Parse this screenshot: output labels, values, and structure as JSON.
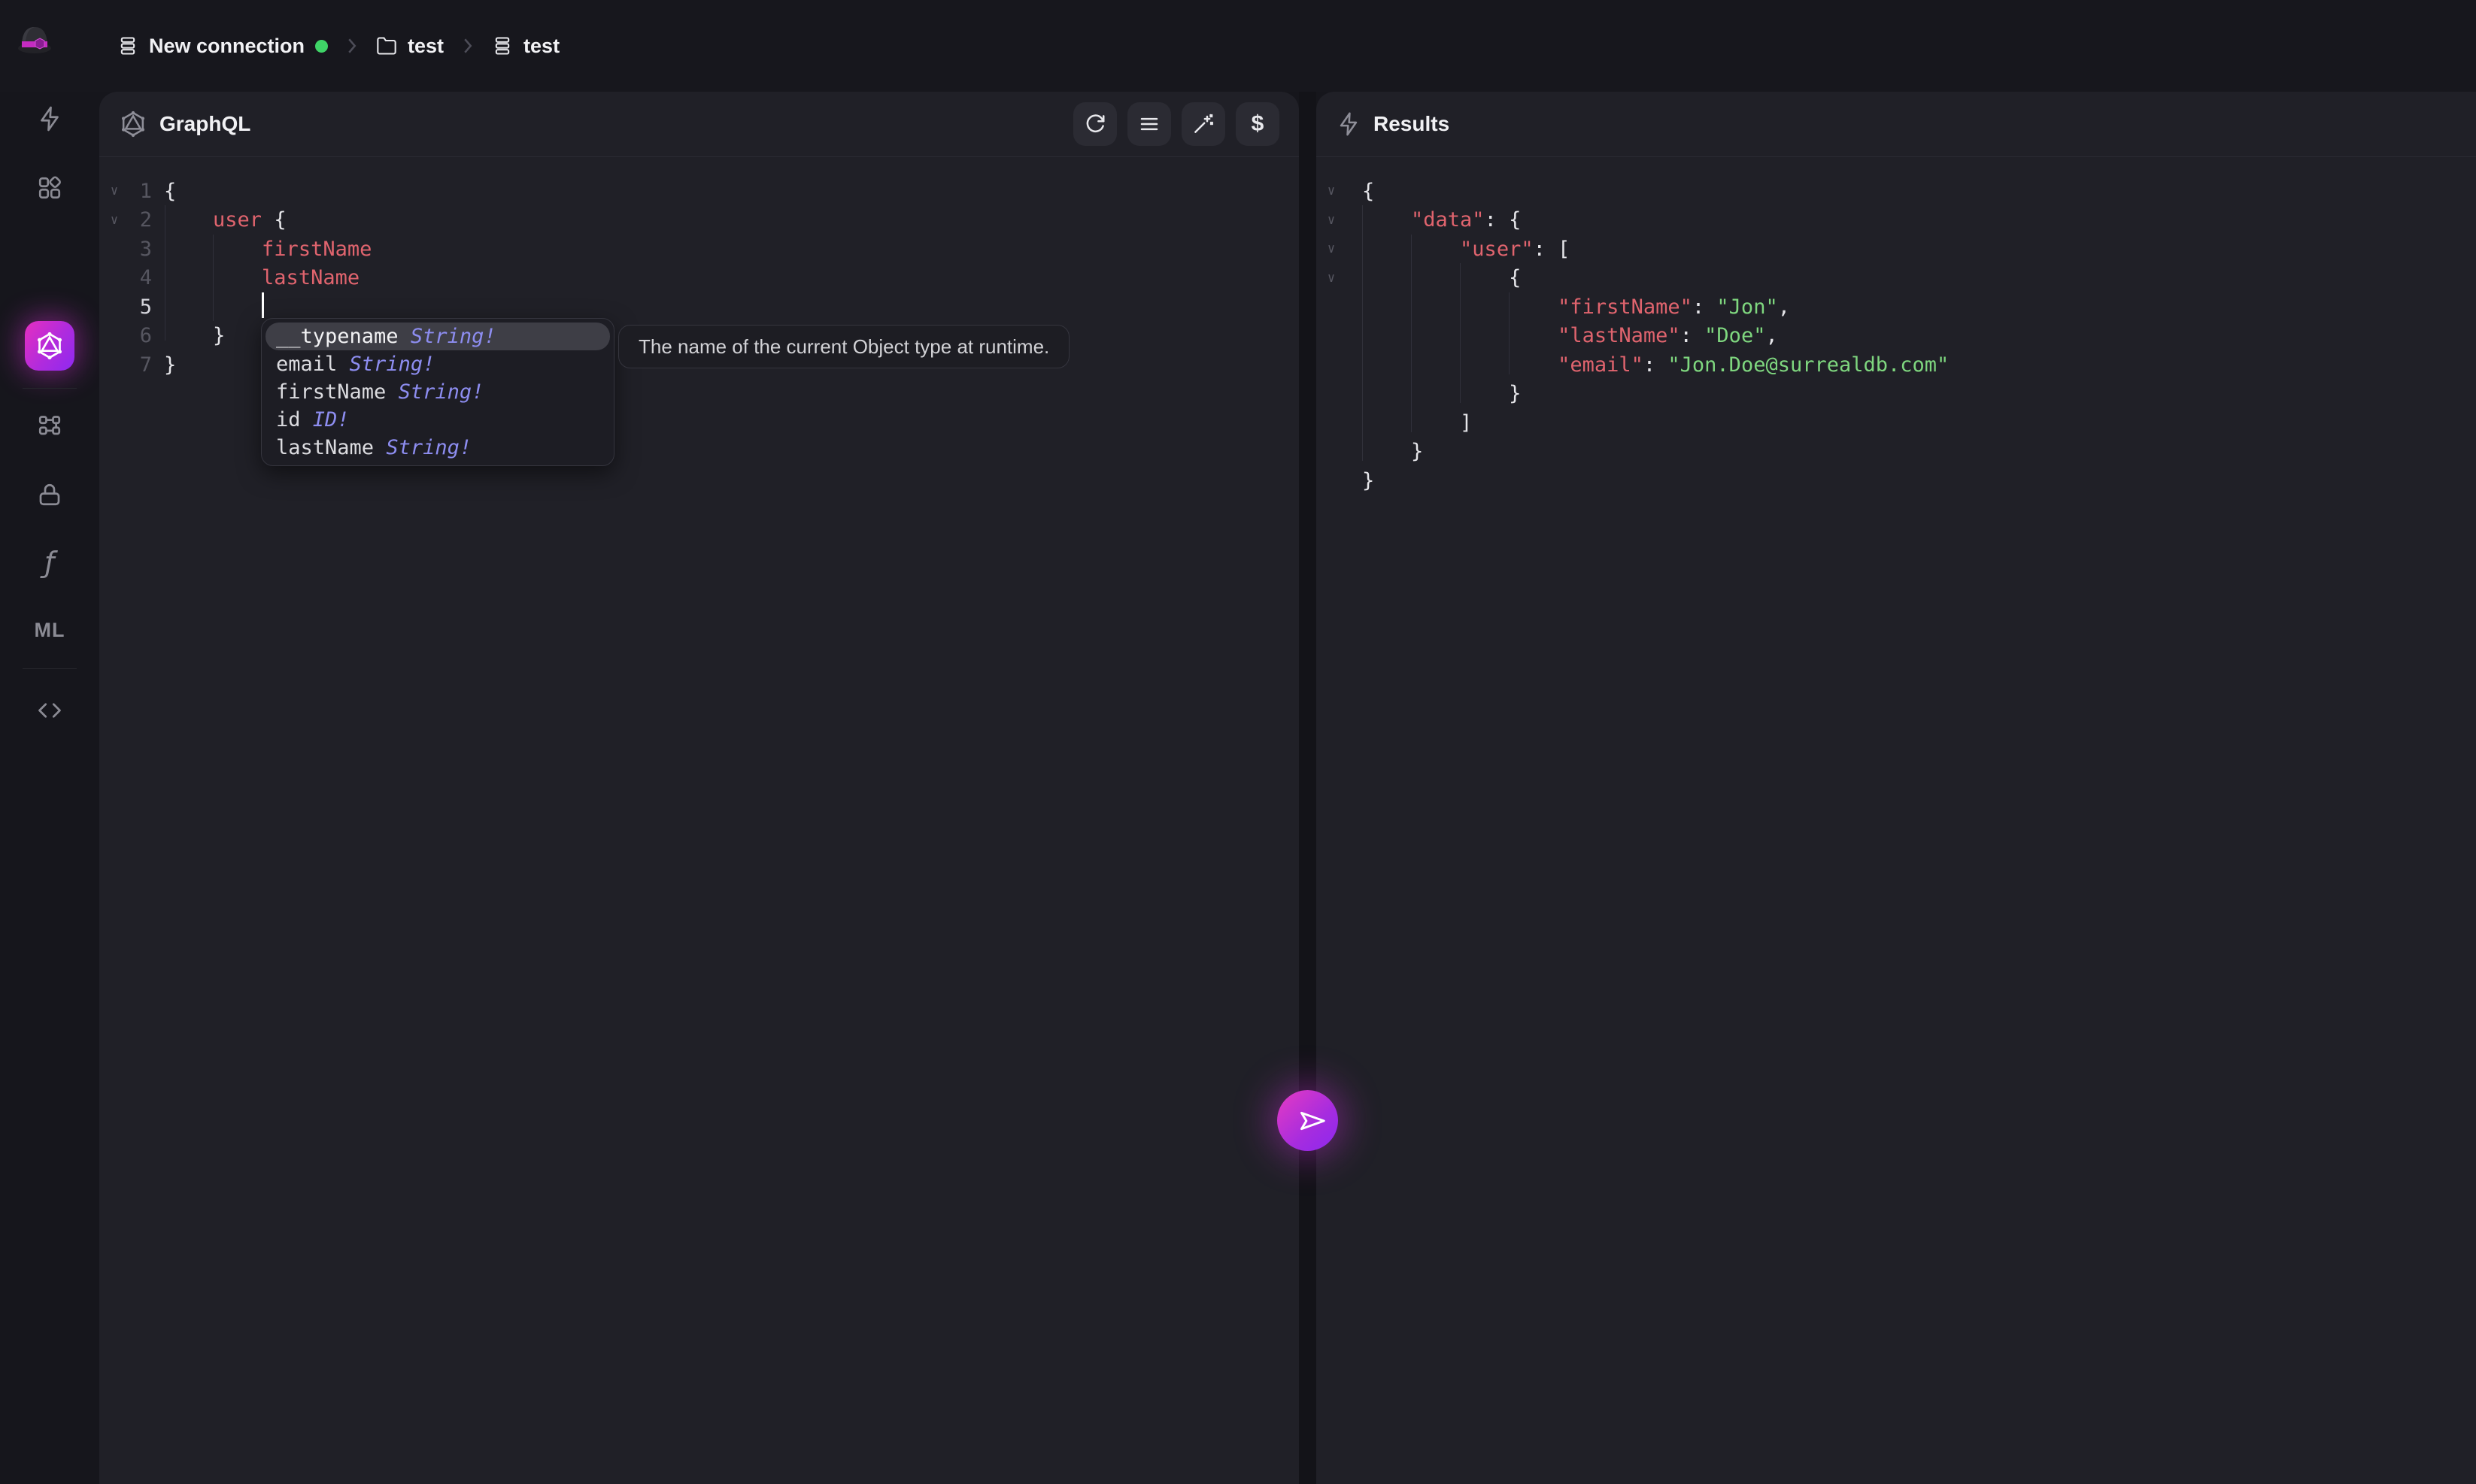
{
  "topbar": {
    "connection_label": "New connection",
    "connection_status_color": "#3fd467",
    "namespace": "test",
    "database": "test"
  },
  "sidebar": {
    "items": [
      {
        "name": "query",
        "icon": "lightning-icon"
      },
      {
        "name": "explorer",
        "icon": "grid-icon"
      },
      {
        "name": "graphql",
        "icon": "graphql-icon",
        "active": true
      },
      {
        "name": "designer",
        "icon": "nodes-icon"
      },
      {
        "name": "auth",
        "icon": "lock-icon"
      },
      {
        "name": "functions",
        "icon": "function-icon",
        "label": "ƒ"
      },
      {
        "name": "models",
        "icon": "ml-label",
        "label": "ML"
      },
      {
        "name": "api-docs",
        "icon": "code-icon"
      }
    ],
    "accent_gradient": [
      "#e52fc0",
      "#8e2af0"
    ]
  },
  "graphql_panel": {
    "title": "GraphQL",
    "toolbar": [
      {
        "name": "run-query",
        "icon": "refresh-icon"
      },
      {
        "name": "format-query",
        "icon": "lines-icon"
      },
      {
        "name": "prettify",
        "icon": "wand-icon"
      },
      {
        "name": "variables",
        "icon": "dollar-icon",
        "label": "$"
      }
    ]
  },
  "editor": {
    "lines": [
      {
        "n": "1",
        "fold": true,
        "tokens": [
          [
            "p",
            "{"
          ]
        ]
      },
      {
        "n": "2",
        "fold": true,
        "tokens": [
          [
            "ws",
            "    "
          ],
          [
            "f",
            "user"
          ],
          [
            "p",
            " {"
          ]
        ]
      },
      {
        "n": "3",
        "fold": false,
        "tokens": [
          [
            "ws",
            "        "
          ],
          [
            "f",
            "firstName"
          ]
        ]
      },
      {
        "n": "4",
        "fold": false,
        "tokens": [
          [
            "ws",
            "        "
          ],
          [
            "f",
            "lastName"
          ]
        ]
      },
      {
        "n": "5",
        "fold": false,
        "active": true,
        "cursor": true,
        "tokens": [
          [
            "ws",
            "        "
          ]
        ]
      },
      {
        "n": "6",
        "fold": false,
        "tokens": [
          [
            "ws",
            "    "
          ],
          [
            "p",
            "}"
          ]
        ]
      },
      {
        "n": "7",
        "fold": false,
        "tokens": [
          [
            "p",
            "}"
          ]
        ]
      }
    ]
  },
  "autocomplete": {
    "items": [
      {
        "label": "__typename",
        "type": "String!",
        "selected": true
      },
      {
        "label": "email",
        "type": "String!"
      },
      {
        "label": "firstName",
        "type": "String!"
      },
      {
        "label": "id",
        "type": "ID!"
      },
      {
        "label": "lastName",
        "type": "String!"
      }
    ]
  },
  "doc_tooltip": {
    "text": "The name of the current Object type at runtime."
  },
  "results_panel": {
    "title": "Results",
    "lines": [
      {
        "fold": true,
        "tokens": [
          [
            "p",
            "{"
          ]
        ]
      },
      {
        "fold": true,
        "tokens": [
          [
            "ws",
            "    "
          ],
          [
            "k",
            "\"data\""
          ],
          [
            "p",
            ": {"
          ]
        ]
      },
      {
        "fold": true,
        "tokens": [
          [
            "ws",
            "        "
          ],
          [
            "k",
            "\"user\""
          ],
          [
            "p",
            ": ["
          ]
        ]
      },
      {
        "fold": true,
        "tokens": [
          [
            "ws",
            "            "
          ],
          [
            "p",
            "{"
          ]
        ]
      },
      {
        "fold": false,
        "tokens": [
          [
            "ws",
            "                "
          ],
          [
            "k",
            "\"firstName\""
          ],
          [
            "p",
            ": "
          ],
          [
            "s",
            "\"Jon\""
          ],
          [
            "p",
            ","
          ]
        ]
      },
      {
        "fold": false,
        "tokens": [
          [
            "ws",
            "                "
          ],
          [
            "k",
            "\"lastName\""
          ],
          [
            "p",
            ": "
          ],
          [
            "s",
            "\"Doe\""
          ],
          [
            "p",
            ","
          ]
        ]
      },
      {
        "fold": false,
        "tokens": [
          [
            "ws",
            "                "
          ],
          [
            "k",
            "\"email\""
          ],
          [
            "p",
            ": "
          ],
          [
            "s",
            "\"Jon.Doe@surrealdb.com\""
          ]
        ]
      },
      {
        "fold": false,
        "tokens": [
          [
            "ws",
            "            "
          ],
          [
            "p",
            "}"
          ]
        ]
      },
      {
        "fold": false,
        "tokens": [
          [
            "ws",
            "        "
          ],
          [
            "p",
            "]"
          ]
        ]
      },
      {
        "fold": false,
        "tokens": [
          [
            "ws",
            "    "
          ],
          [
            "p",
            "}"
          ]
        ]
      },
      {
        "fold": false,
        "tokens": [
          [
            "p",
            "}"
          ]
        ]
      }
    ],
    "result_values": {
      "firstName": "Jon",
      "lastName": "Doe",
      "email": "Jon.Doe@surrealdb.com"
    }
  },
  "colors": {
    "chrome_bg": "#16161c",
    "panel_bg": "#202027",
    "accent_pink": "#e52fc0",
    "accent_purple": "#8e2af0",
    "field": "#e0646e",
    "string": "#7fd77f",
    "type": "#8d8df0"
  }
}
